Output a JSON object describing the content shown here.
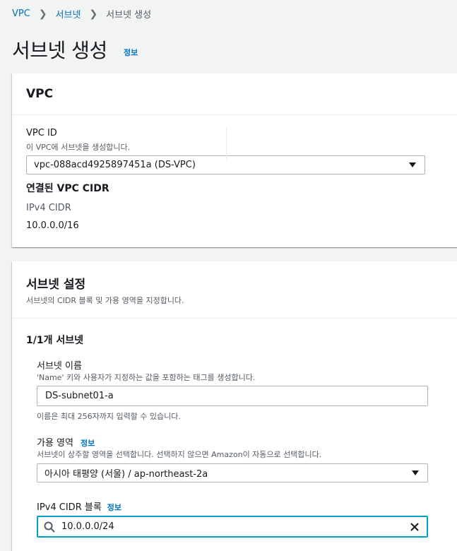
{
  "breadcrumb": {
    "items": [
      "VPC",
      "서브넷"
    ],
    "current": "서브넷 생성"
  },
  "page": {
    "title": "서브넷 생성",
    "info_link": "정보"
  },
  "vpc_section": {
    "heading": "VPC",
    "vpc_id_label": "VPC ID",
    "vpc_id_desc": "이 VPC에 서브넷을 생성합니다.",
    "vpc_id_value": "vpc-088acd4925897451a (DS-VPC)",
    "cidr_heading": "연결된 VPC CIDR",
    "ipv4_label": "IPv4 CIDR",
    "ipv4_value": "10.0.0.0/16"
  },
  "subnet_section": {
    "heading": "서브넷 설정",
    "desc": "서브넷의 CIDR 블록 및 가용 영역을 지정합니다.",
    "count_label": "1/1개 서브넷",
    "name_label": "서브넷 이름",
    "name_desc": "'Name' 키와 사용자가 지정하는 값을 포함하는 태그를 생성합니다.",
    "name_value": "DS-subnet01-a",
    "name_hint": "이름은 최대 256자까지 입력할 수 있습니다.",
    "az_label": "가용 영역",
    "az_info": "정보",
    "az_desc": "서브넷이 상주할 영역을 선택합니다. 선택하지 않으면 Amazon이 자동으로 선택합니다.",
    "az_value": "아시아 태평양 (서울) / ap-northeast-2a",
    "cidr_label": "IPv4 CIDR 블록",
    "cidr_info": "정보",
    "cidr_value": "10.0.0.0/24"
  },
  "icons": {
    "search": "search-icon",
    "clear": "close-icon",
    "dropdown": "caret-down-icon",
    "breadcrumb_sep": "chevron-right-icon"
  },
  "colors": {
    "link": "#0073bb",
    "focus": "#00a1c9",
    "background": "#f2f3f3"
  }
}
